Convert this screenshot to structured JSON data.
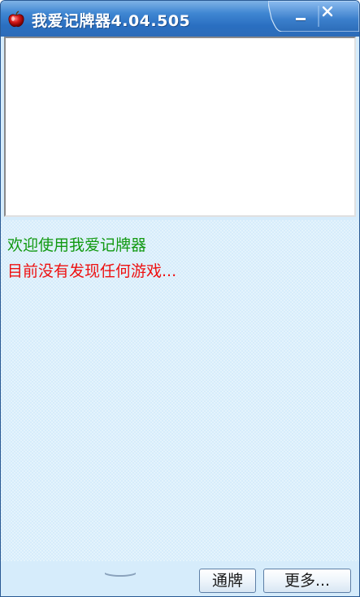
{
  "window": {
    "title": "我爱记牌器4.04.505",
    "icon": "red-apple-icon",
    "accent_color": "#2a6fc1"
  },
  "controls": {
    "minimize_icon": "minimize-icon",
    "close_icon": "close-icon"
  },
  "log": {
    "welcome": "欢迎使用我爱记牌器",
    "welcome_color": "#119911",
    "status": "目前没有发现任何游戏...",
    "status_color": "#ee1111"
  },
  "buttons": {
    "tongpai": "通牌",
    "more": "更多..."
  }
}
